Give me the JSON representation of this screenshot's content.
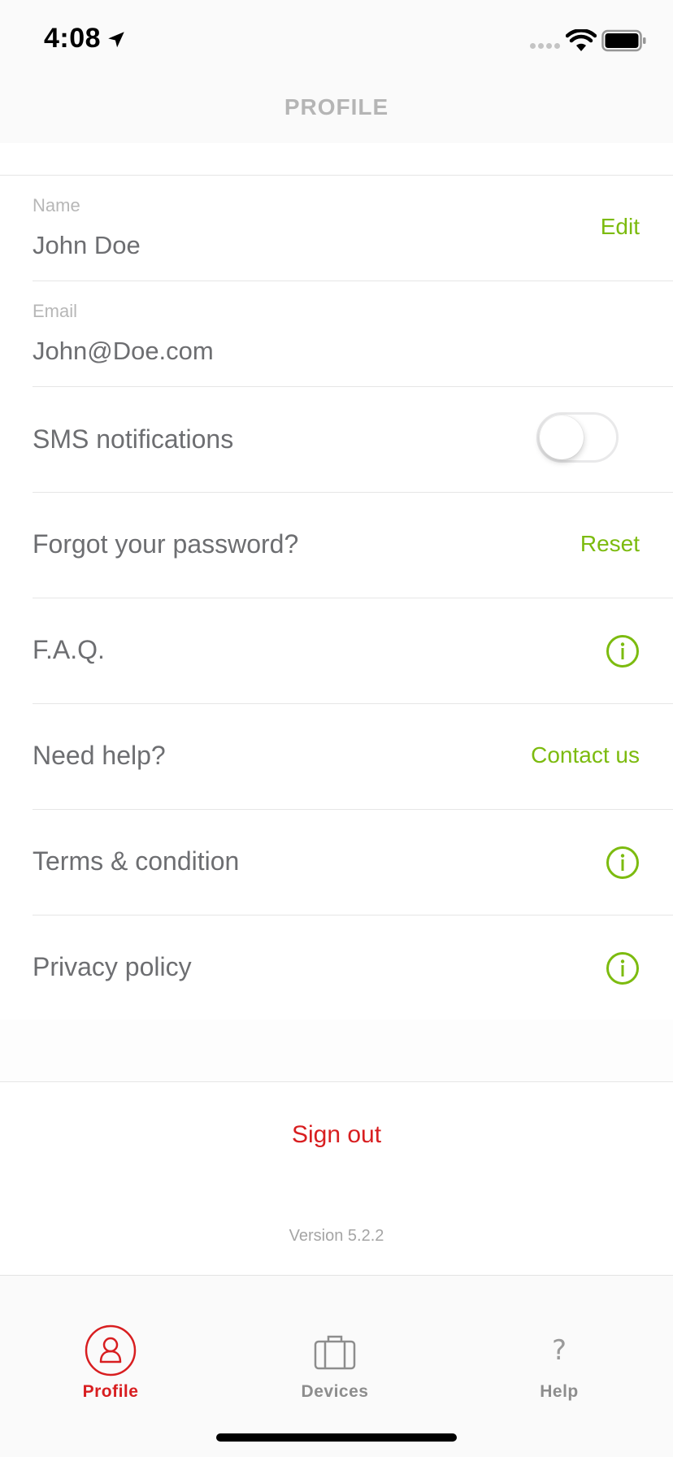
{
  "status_bar": {
    "time": "4:08"
  },
  "header": {
    "title": "PROFILE"
  },
  "profile": {
    "name": {
      "label": "Name",
      "value": "John Doe",
      "action": "Edit"
    },
    "email": {
      "label": "Email",
      "value": "John@Doe.com"
    },
    "sms": {
      "label": "SMS notifications",
      "enabled": false
    },
    "password": {
      "label": "Forgot your password?",
      "action": "Reset"
    },
    "faq": {
      "label": "F.A.Q.",
      "icon": "info-icon"
    },
    "help": {
      "label": "Need help?",
      "action": "Contact us"
    },
    "terms": {
      "label": "Terms & condition",
      "icon": "info-icon"
    },
    "privacy": {
      "label": "Privacy policy",
      "icon": "info-icon"
    }
  },
  "signout": {
    "label": "Sign out"
  },
  "version": {
    "text": "Version 5.2.2"
  },
  "tabbar": {
    "tabs": [
      {
        "label": "Profile",
        "icon": "user-icon",
        "active": true
      },
      {
        "label": "Devices",
        "icon": "suitcase-icon",
        "active": false
      },
      {
        "label": "Help",
        "icon": "question-icon",
        "active": false
      }
    ]
  },
  "colors": {
    "accent_green": "#7cbb0f",
    "accent_red": "#d81e20",
    "text": "#6d6e71",
    "muted": "#b7b7b7"
  }
}
